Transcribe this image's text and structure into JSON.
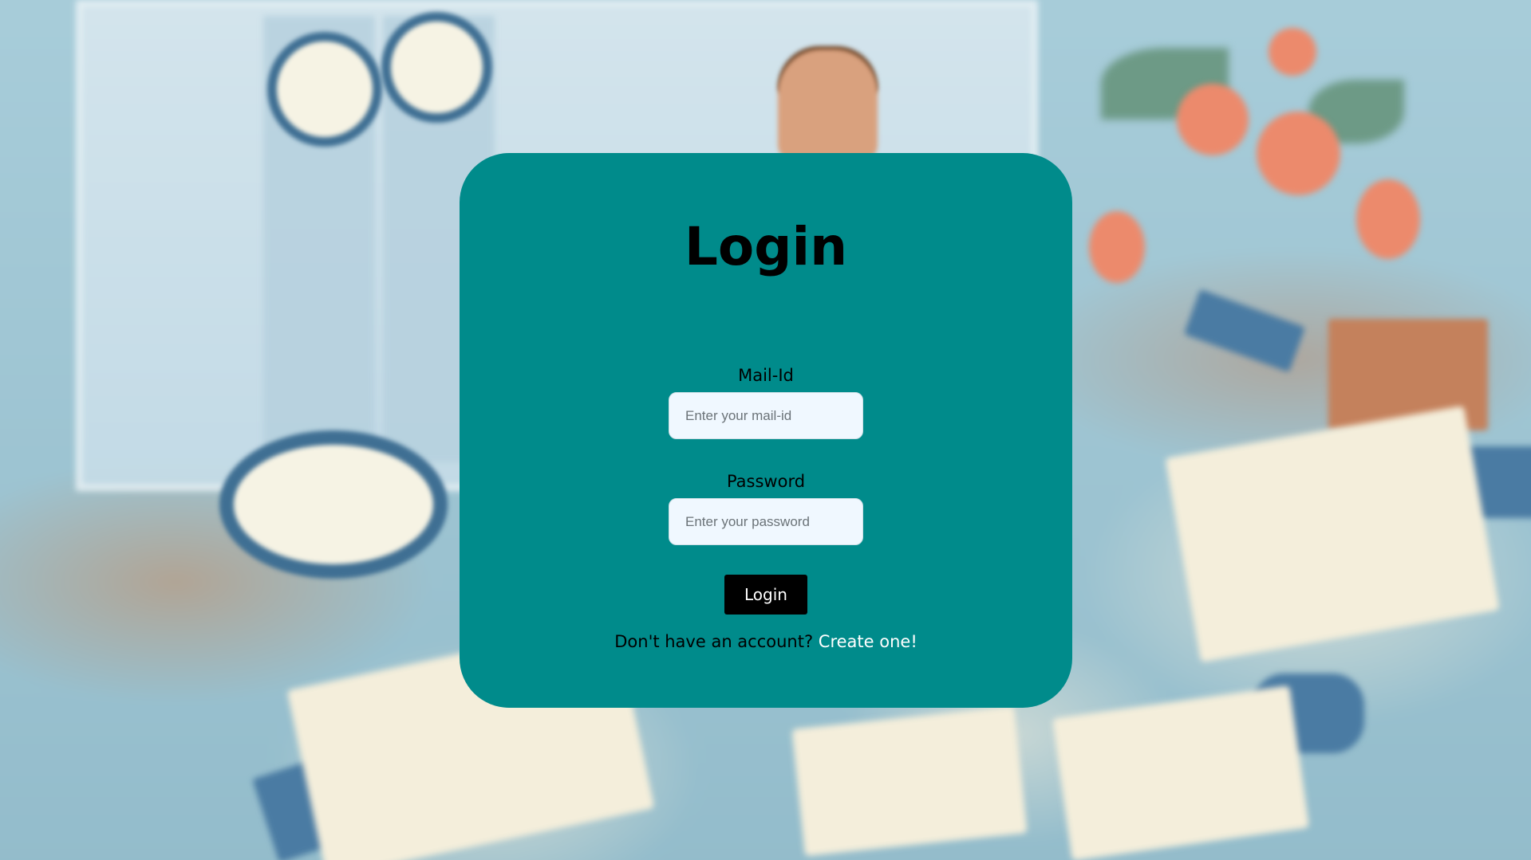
{
  "login_form": {
    "title": "Login",
    "mail": {
      "label": "Mail-Id",
      "placeholder": "Enter your mail-id",
      "value": ""
    },
    "password": {
      "label": "Password",
      "placeholder": "Enter your password",
      "value": ""
    },
    "submit_label": "Login",
    "signup_prompt": "Don't have an account?",
    "signup_link": "Create one!"
  },
  "colors": {
    "card_background": "#008b8b",
    "input_background": "#f0f8ff",
    "button_background": "#000000",
    "button_text": "#ffffff",
    "link_text": "#ffffff",
    "page_background": "#9fc6d4"
  }
}
